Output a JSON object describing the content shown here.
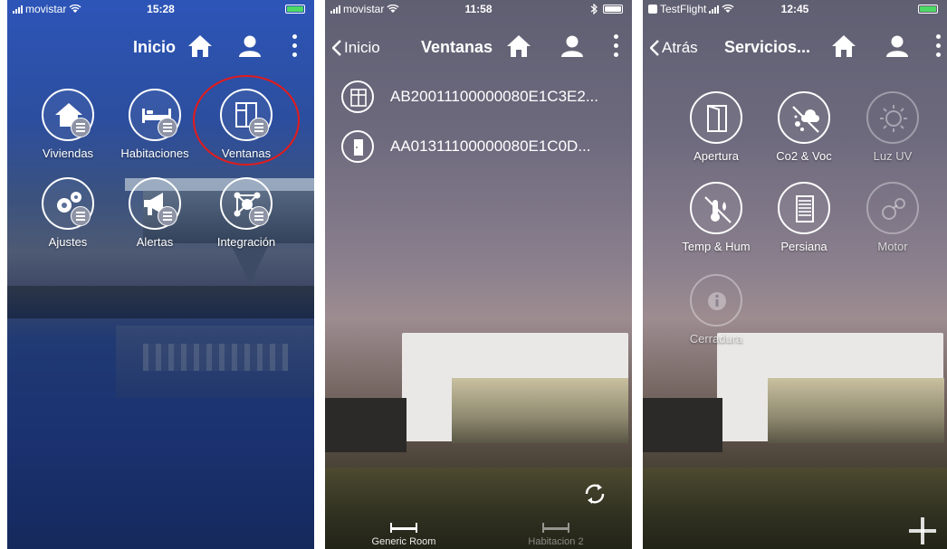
{
  "screen1": {
    "status": {
      "carrier": "movistar",
      "time": "15:28"
    },
    "nav": {
      "title": "Inicio"
    },
    "icons": {
      "home": "home-icon",
      "user": "user-icon",
      "more": "more-vertical-icon"
    },
    "tiles": [
      {
        "label": "Viviendas",
        "icon": "house-icon"
      },
      {
        "label": "Habitaciones",
        "icon": "bed-icon"
      },
      {
        "label": "Ventanas",
        "icon": "window-icon"
      },
      {
        "label": "Ajustes",
        "icon": "gears-icon"
      },
      {
        "label": "Alertas",
        "icon": "megaphone-icon"
      },
      {
        "label": "Integración",
        "icon": "network-icon"
      }
    ],
    "highlight_color": "#e41b1b"
  },
  "screen2": {
    "status": {
      "carrier": "movistar",
      "time": "11:58"
    },
    "nav": {
      "back": "Inicio",
      "title": "Ventanas"
    },
    "devices": [
      {
        "label": "AB20011100000080E1C3E2...",
        "icon": "window-icon"
      },
      {
        "label": "AA01311100000080E1C0D...",
        "icon": "door-icon"
      }
    ],
    "bottom_tabs": [
      {
        "label": "Generic Room",
        "icon": "bed-icon"
      },
      {
        "label": "Habitacion 2",
        "icon": "bed-icon"
      }
    ]
  },
  "screen3": {
    "status": {
      "carrier": "TestFlight",
      "time": "12:45"
    },
    "nav": {
      "back": "Atrás",
      "title": "Servicios..."
    },
    "tiles": [
      {
        "label": "Apertura",
        "icon": "door-open-icon",
        "enabled": true
      },
      {
        "label": "Co2 & Voc",
        "icon": "air-quality-icon",
        "enabled": true
      },
      {
        "label": "Luz UV",
        "icon": "sun-icon",
        "enabled": false
      },
      {
        "label": "Temp & Hum",
        "icon": "thermometer-icon",
        "enabled": true
      },
      {
        "label": "Persiana",
        "icon": "blind-icon",
        "enabled": true
      },
      {
        "label": "Motor",
        "icon": "motor-icon",
        "enabled": false
      },
      {
        "label": "Cerradura",
        "icon": "info-icon",
        "enabled": false
      }
    ]
  },
  "colors": {
    "battery_green": "#4cd964",
    "accent_red": "#e41b1b"
  }
}
